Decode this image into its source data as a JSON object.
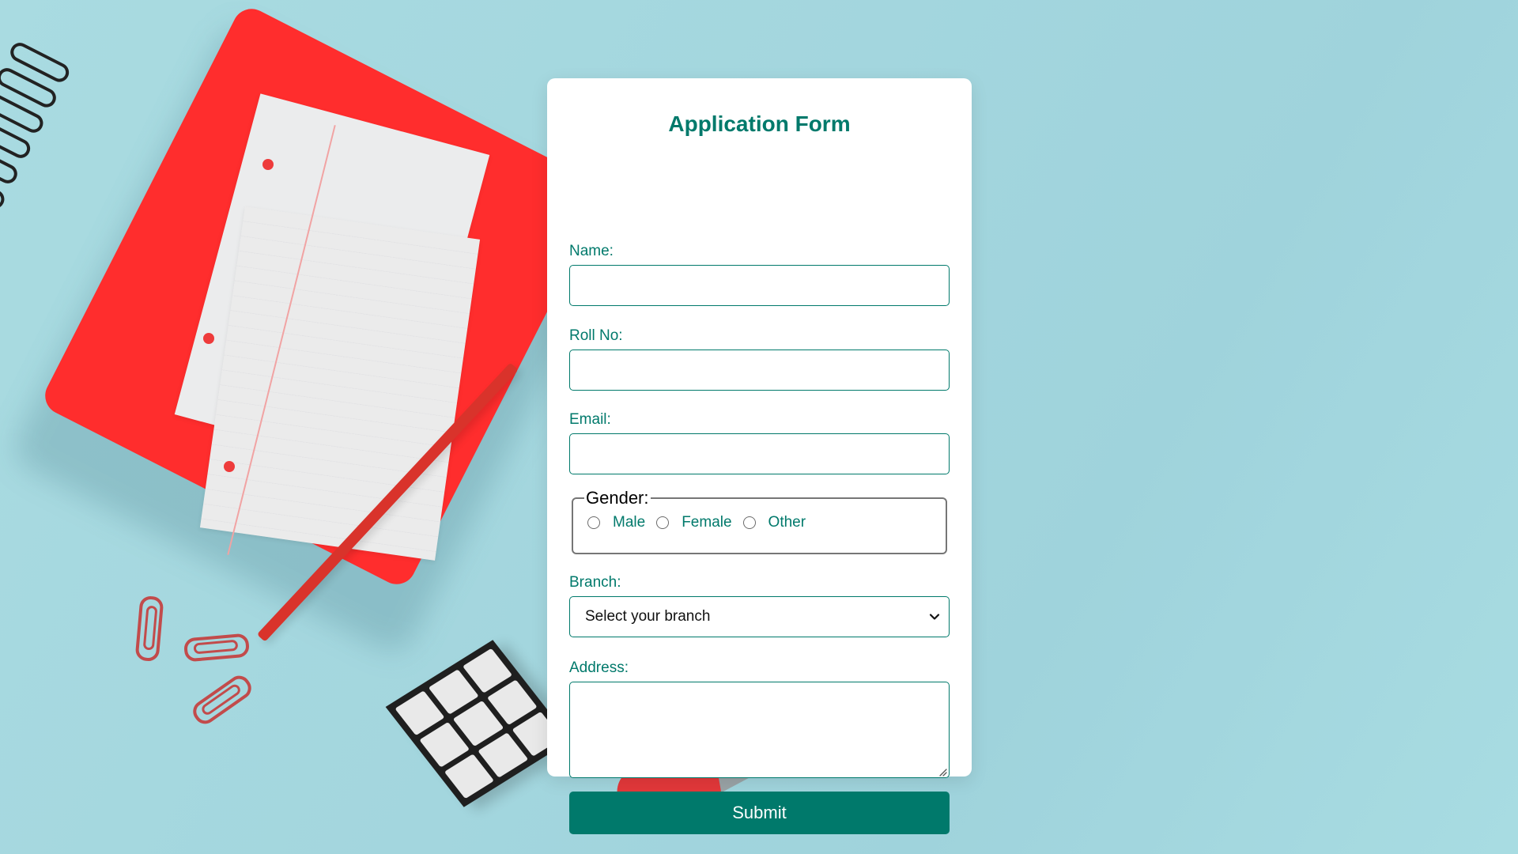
{
  "form": {
    "title": "Application Form",
    "fields": {
      "name": {
        "label": "Name:",
        "value": ""
      },
      "roll_no": {
        "label": "Roll No:",
        "value": ""
      },
      "email": {
        "label": "Email:",
        "value": ""
      },
      "branch": {
        "label": "Branch:",
        "selected": "Select your branch"
      },
      "address": {
        "label": "Address:",
        "value": ""
      }
    },
    "gender": {
      "legend": "Gender:",
      "options": [
        "Male",
        "Female",
        "Other"
      ]
    },
    "submit_label": "Submit"
  },
  "colors": {
    "accent": "#00796b",
    "background": "#a5d8df",
    "card": "#ffffff"
  },
  "icons": {
    "select": "chevron-down-icon",
    "textarea": "resize-grip-icon"
  }
}
